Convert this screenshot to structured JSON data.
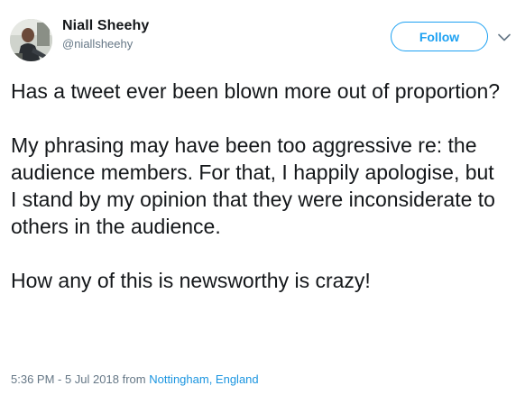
{
  "author": {
    "display_name": "Niall Sheehy",
    "handle": "@niallsheehy",
    "avatar_icon": "user-photo-avatar"
  },
  "actions": {
    "follow_label": "Follow",
    "more_icon": "chevron-down-icon"
  },
  "tweet": {
    "paragraphs": [
      "Has a tweet ever been blown more out of proportion?",
      "My phrasing may have been too aggressive re: the audience members. For that, I happily apologise, but I stand by my opinion that they were inconsiderate to others in the audience.",
      "How any of this is newsworthy is crazy!"
    ]
  },
  "meta": {
    "timestamp": "5:36 PM - 5 Jul 2018",
    "from_label": "from",
    "location": "Nottingham, England"
  },
  "colors": {
    "accent": "#1da1f2",
    "link": "#1b95e0",
    "secondary_text": "#657786",
    "primary_text": "#14171a"
  }
}
